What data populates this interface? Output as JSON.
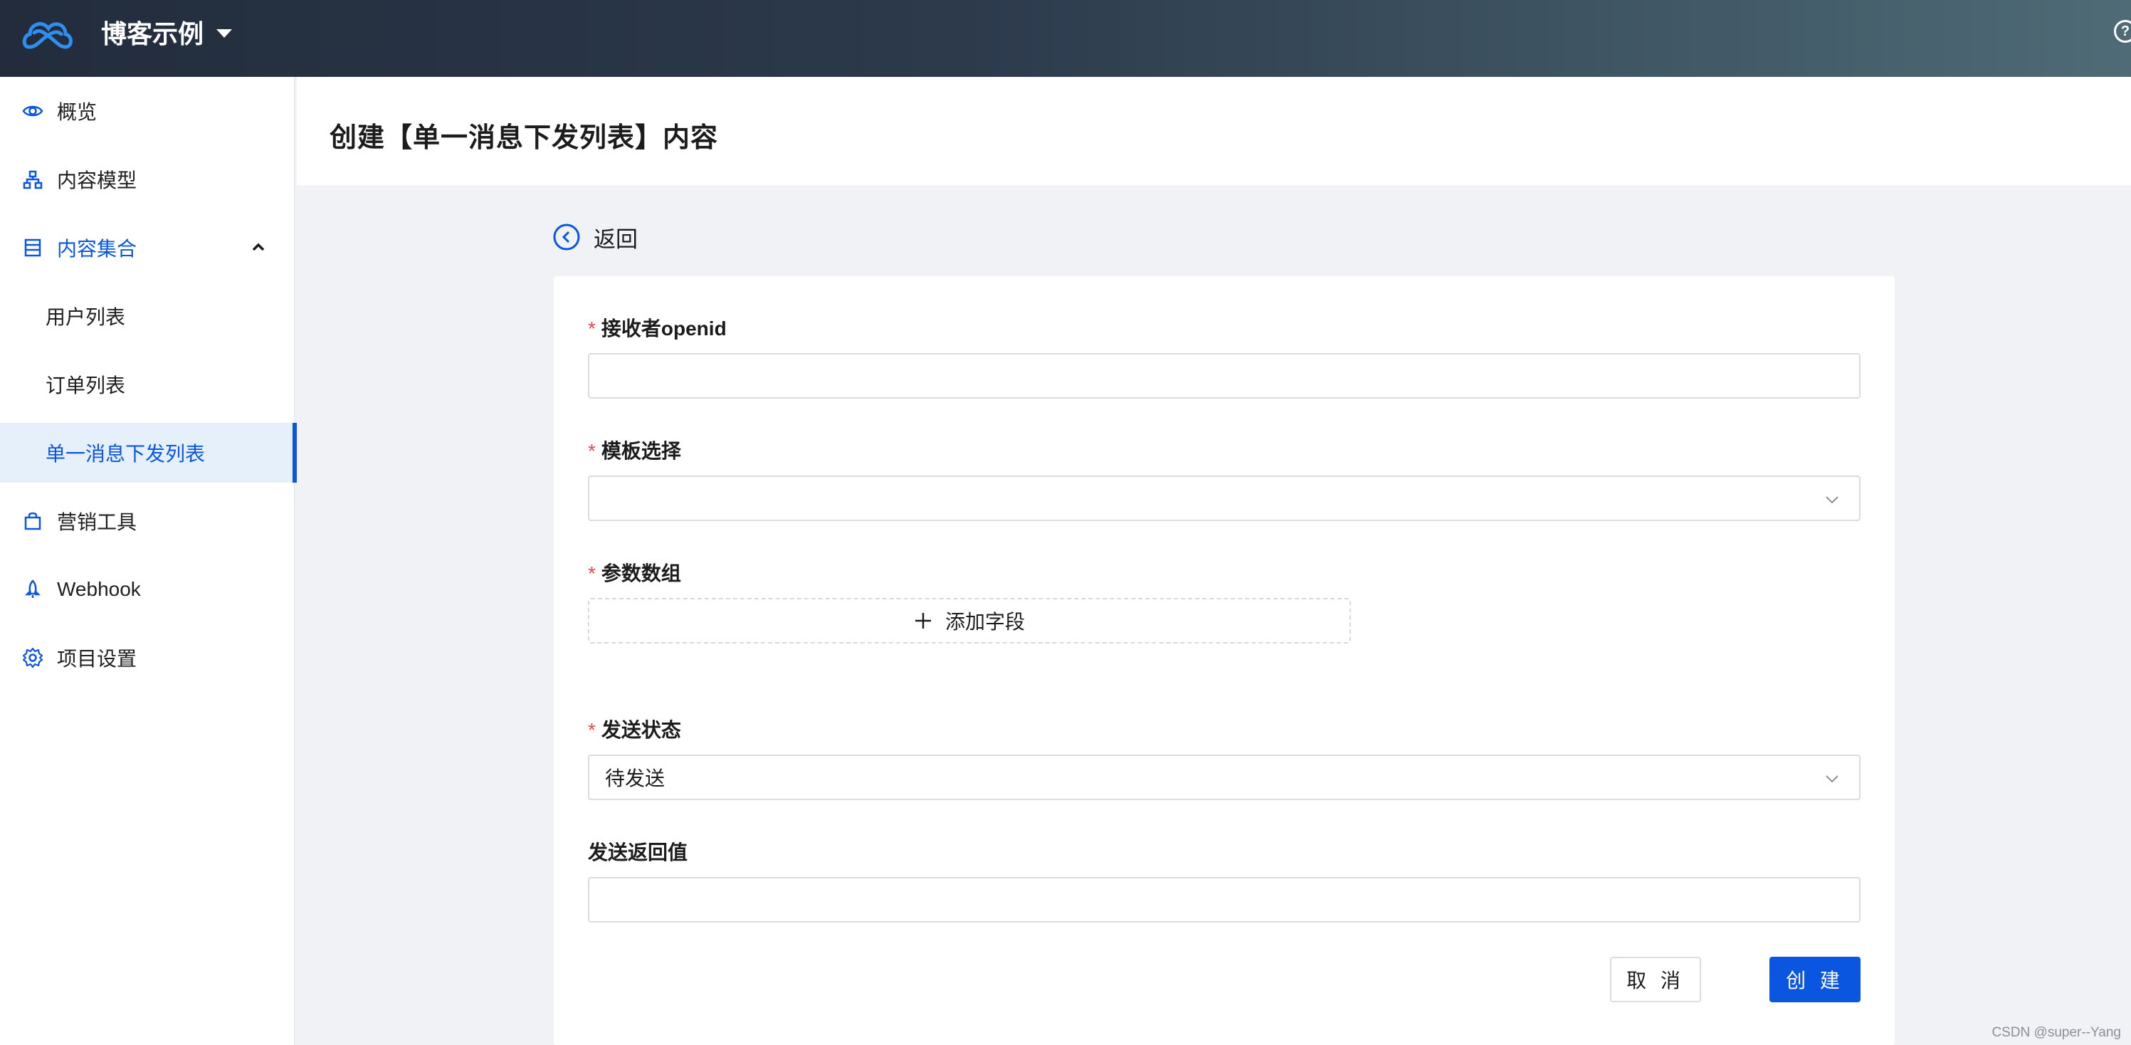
{
  "header": {
    "project_name": "博客示例",
    "help_icon": "?"
  },
  "sidebar": {
    "items": [
      {
        "label": "概览",
        "icon": "eye-icon"
      },
      {
        "label": "内容模型",
        "icon": "sitemap-icon"
      },
      {
        "label": "内容集合",
        "icon": "list-icon",
        "expanded": true
      },
      {
        "label": "用户列表"
      },
      {
        "label": "订单列表"
      },
      {
        "label": "单一消息下发列表",
        "active": true
      },
      {
        "label": "营销工具",
        "icon": "bag-icon"
      },
      {
        "label": "Webhook",
        "icon": "rocket-icon"
      },
      {
        "label": "项目设置",
        "icon": "gear-icon"
      }
    ]
  },
  "page": {
    "title": "创建【单一消息下发列表】内容",
    "back_label": "返回"
  },
  "form": {
    "required_mark": "*",
    "fields": {
      "openid": {
        "label": "接收者openid",
        "value": ""
      },
      "template": {
        "label": "模板选择",
        "value": ""
      },
      "params": {
        "label": "参数数组",
        "add_label": "添加字段"
      },
      "status": {
        "label": "发送状态",
        "value": "待发送"
      },
      "return_value": {
        "label": "发送返回值",
        "value": ""
      }
    },
    "cancel_label": "取 消",
    "create_label": "创 建"
  },
  "watermark": "CSDN @super--Yang",
  "colors": {
    "accent": "#0a56e0",
    "required": "#e5484d",
    "active_bg": "#e5f0fb"
  }
}
